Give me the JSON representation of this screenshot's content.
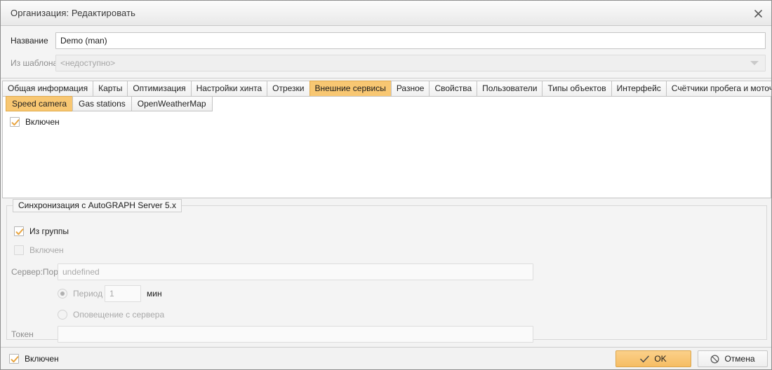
{
  "window": {
    "title": "Организация: Редактировать",
    "close_icon": "close-icon"
  },
  "header": {
    "name_label": "Название",
    "name_value": "Demo (man)",
    "template_label": "Из шаблона",
    "template_value": "<недоступно>",
    "template_dropdown_icon": "chevron-down-icon"
  },
  "tabs": [
    {
      "label": "Общая информация",
      "active": false
    },
    {
      "label": "Карты",
      "active": false
    },
    {
      "label": "Оптимизация",
      "active": false
    },
    {
      "label": "Настройки хинта",
      "active": false
    },
    {
      "label": "Отрезки",
      "active": false
    },
    {
      "label": "Внешние сервисы",
      "active": true
    },
    {
      "label": "Разное",
      "active": false
    },
    {
      "label": "Свойства",
      "active": false
    },
    {
      "label": "Пользователи",
      "active": false
    },
    {
      "label": "Типы объектов",
      "active": false
    },
    {
      "label": "Интерфейс",
      "active": false
    },
    {
      "label": "Счётчики пробега и моточасов",
      "active": false
    }
  ],
  "subtabs": [
    {
      "label": "Speed camera",
      "active": true
    },
    {
      "label": "Gas stations",
      "active": false
    },
    {
      "label": "OpenWeatherMap",
      "active": false
    }
  ],
  "panel": {
    "enabled_label": "Включен",
    "enabled_checked": true
  },
  "sync_group": {
    "title": "Синхронизация с AutoGRAPH Server 5.x",
    "from_group_label": "Из группы",
    "from_group_checked": true,
    "enabled_label": "Включен",
    "enabled_checked": false,
    "server_port_label": "Сервер:Порт",
    "server_port_value": "undefined",
    "period_radio_label": "Период",
    "period_radio_selected": true,
    "period_value": "1",
    "period_unit": "мин",
    "server_notify_radio_label": "Оповещение с сервера",
    "server_notify_selected": false,
    "token_label": "Токен",
    "token_value": ""
  },
  "statusbar": {
    "enabled_label": "Включен",
    "enabled_checked": true,
    "ok_label": "OK",
    "ok_icon": "check-icon",
    "cancel_label": "Отмена",
    "cancel_icon": "ban-icon"
  },
  "colors": {
    "accent_orange": "#f8c772",
    "accent_orange_border": "#e0aa4c",
    "check_orange": "#e8a33d",
    "window_bg": "#f3f3f3",
    "panel_white": "#ffffff"
  }
}
